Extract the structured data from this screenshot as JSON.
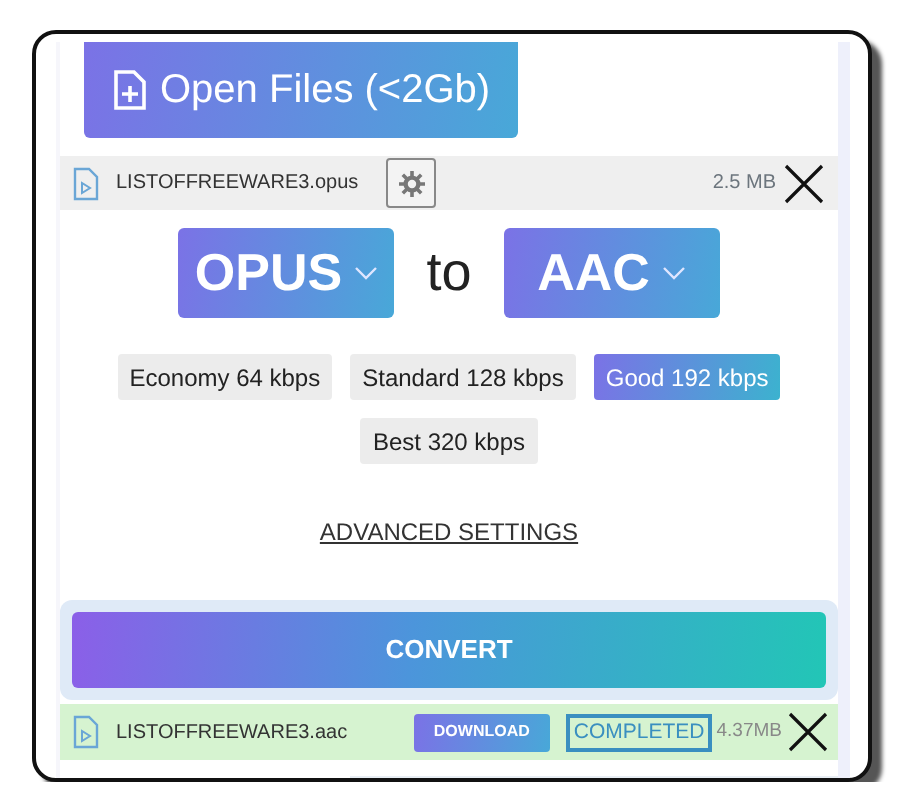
{
  "open_button": {
    "label": "Open Files (<2Gb)"
  },
  "source_file": {
    "name": "LISTOFFREEWARE3.opus",
    "size": "2.5 MB"
  },
  "conversion": {
    "from": "OPUS",
    "connector": "to",
    "to": "AAC"
  },
  "quality_options": [
    {
      "label": "Economy 64 kbps",
      "selected": false
    },
    {
      "label": "Standard 128 kbps",
      "selected": false
    },
    {
      "label": "Good 192 kbps",
      "selected": true
    },
    {
      "label": "Best 320 kbps",
      "selected": false
    }
  ],
  "advanced_link": "ADVANCED SETTINGS",
  "convert_button": "CONVERT",
  "result_file": {
    "name": "LISTOFFREEWARE3.aac",
    "download": "DOWNLOAD",
    "status": "COMPLETED",
    "size": "4.37MB"
  }
}
